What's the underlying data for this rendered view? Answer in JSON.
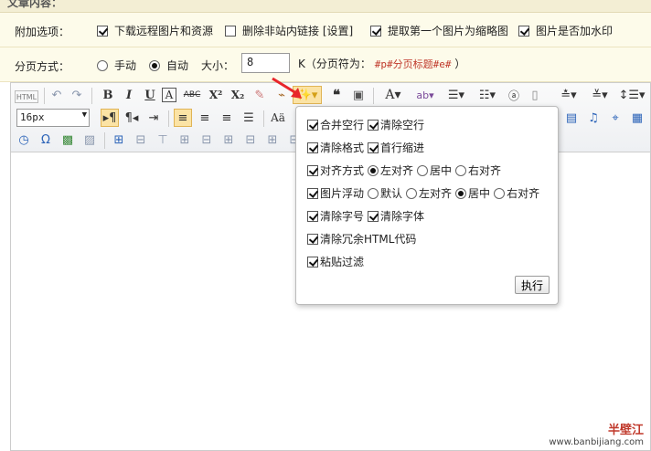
{
  "header": {
    "section_title": "文章内容："
  },
  "options": {
    "label": "附加选项：",
    "items": [
      {
        "label": "下载远程图片和资源",
        "checked": true
      },
      {
        "label": "删除非站内链接 [设置]",
        "checked": false
      },
      {
        "label": "提取第一个图片为缩略图",
        "checked": true
      },
      {
        "label": "图片是否加水印",
        "checked": true
      }
    ]
  },
  "paging": {
    "label": "分页方式：",
    "manual": "手动",
    "auto": "自动",
    "selected": "auto",
    "size_label": "大小：",
    "size_value": "8",
    "unit_hint": "K（分页符为：",
    "separator_code": "#p#分页标题#e#",
    "hint_end": "）"
  },
  "toolbar": {
    "font_size": "16px",
    "icons": [
      "source-icon",
      "undo-icon",
      "redo-icon",
      "bold-icon",
      "italic-icon",
      "underline-icon",
      "fontborder-icon",
      "strikethrough-icon",
      "superscript-icon",
      "subscript-icon",
      "eraser-icon",
      "formatmatch-icon",
      "autotypeset-icon",
      "blockquote-icon",
      "pasteplain-icon",
      "forecolor-icon",
      "backcolor-icon",
      "ordered-list-icon",
      "unordered-list-icon",
      "selectall-icon",
      "cleardoc-icon",
      "rowspacing-top-icon",
      "rowspacing-bottom-icon",
      "lineheight-icon"
    ]
  },
  "popup": {
    "merge_empty": "合并空行",
    "clear_empty": "清除空行",
    "clear_format": "清除格式",
    "first_indent": "首行缩进",
    "align_label": "对齐方式",
    "align_left": "左对齐",
    "align_center": "居中",
    "align_right": "右对齐",
    "float_label": "图片浮动",
    "float_default": "默认",
    "float_left": "左对齐",
    "float_center": "居中",
    "float_right": "右对齐",
    "clear_fontsize": "清除字号",
    "clear_fontfamily": "清除字体",
    "clear_html": "清除冗余HTML代码",
    "paste_filter": "粘贴过滤",
    "run": "执行"
  },
  "watermark": {
    "brand": "半壁江",
    "url": "www.banbijiang.com"
  },
  "colors": {
    "annotation_arrow": "#e8252b",
    "active_button": "#fbe3a5"
  }
}
